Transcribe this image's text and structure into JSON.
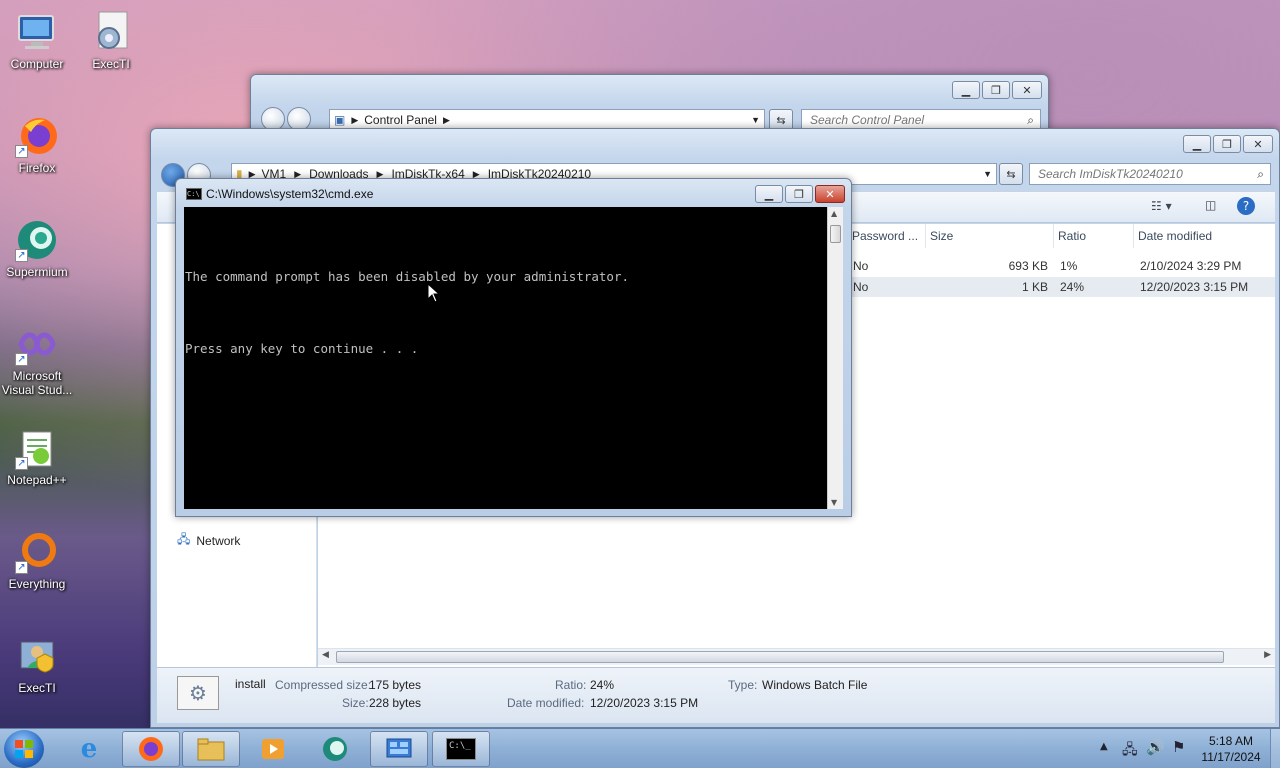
{
  "desktop": {
    "icons": [
      {
        "label": "Computer"
      },
      {
        "label": "ExecTI"
      },
      {
        "label": "Firefox"
      },
      {
        "label": "Supermium"
      },
      {
        "label": "Microsoft Visual Stud..."
      },
      {
        "label": "Notepad++"
      },
      {
        "label": "Everything"
      },
      {
        "label": "ExecTI"
      }
    ]
  },
  "control_panel_window": {
    "breadcrumb": "Control Panel",
    "search_placeholder": "Search Control Panel"
  },
  "explorer_window": {
    "breadcrumb": [
      "VM1",
      "Downloads",
      "ImDiskTk-x64",
      "ImDiskTk20240210"
    ],
    "search_placeholder": "Search ImDiskTk20240210",
    "columns": [
      "Password ...",
      "Size",
      "Ratio",
      "Date modified"
    ],
    "rows": [
      {
        "password": "No",
        "size": "693 KB",
        "ratio": "1%",
        "date": "2/10/2024 3:29 PM"
      },
      {
        "password": "No",
        "size": "1 KB",
        "ratio": "24%",
        "date": "12/20/2023 3:15 PM"
      }
    ],
    "nav_network": "Network",
    "details": {
      "name": "install",
      "compressed_label": "Compressed size:",
      "compressed_value": "175 bytes",
      "size_label": "Size:",
      "size_value": "228 bytes",
      "ratio_label": "Ratio:",
      "ratio_value": "24%",
      "date_label": "Date modified:",
      "date_value": "12/20/2023 3:15 PM",
      "type_label": "Type:",
      "type_value": "Windows Batch File"
    }
  },
  "cmd_window": {
    "title": "C:\\Windows\\system32\\cmd.exe",
    "line1": "The command prompt has been disabled by your administrator.",
    "line2": "Press any key to continue . . ."
  },
  "taskbar": {
    "time": "5:18 AM",
    "date": "11/17/2024"
  },
  "colors": {
    "taskbar": "#8fb0d6",
    "console_bg": "#000000",
    "console_text": "#c0c0c0",
    "close_red": "#c8422e"
  }
}
